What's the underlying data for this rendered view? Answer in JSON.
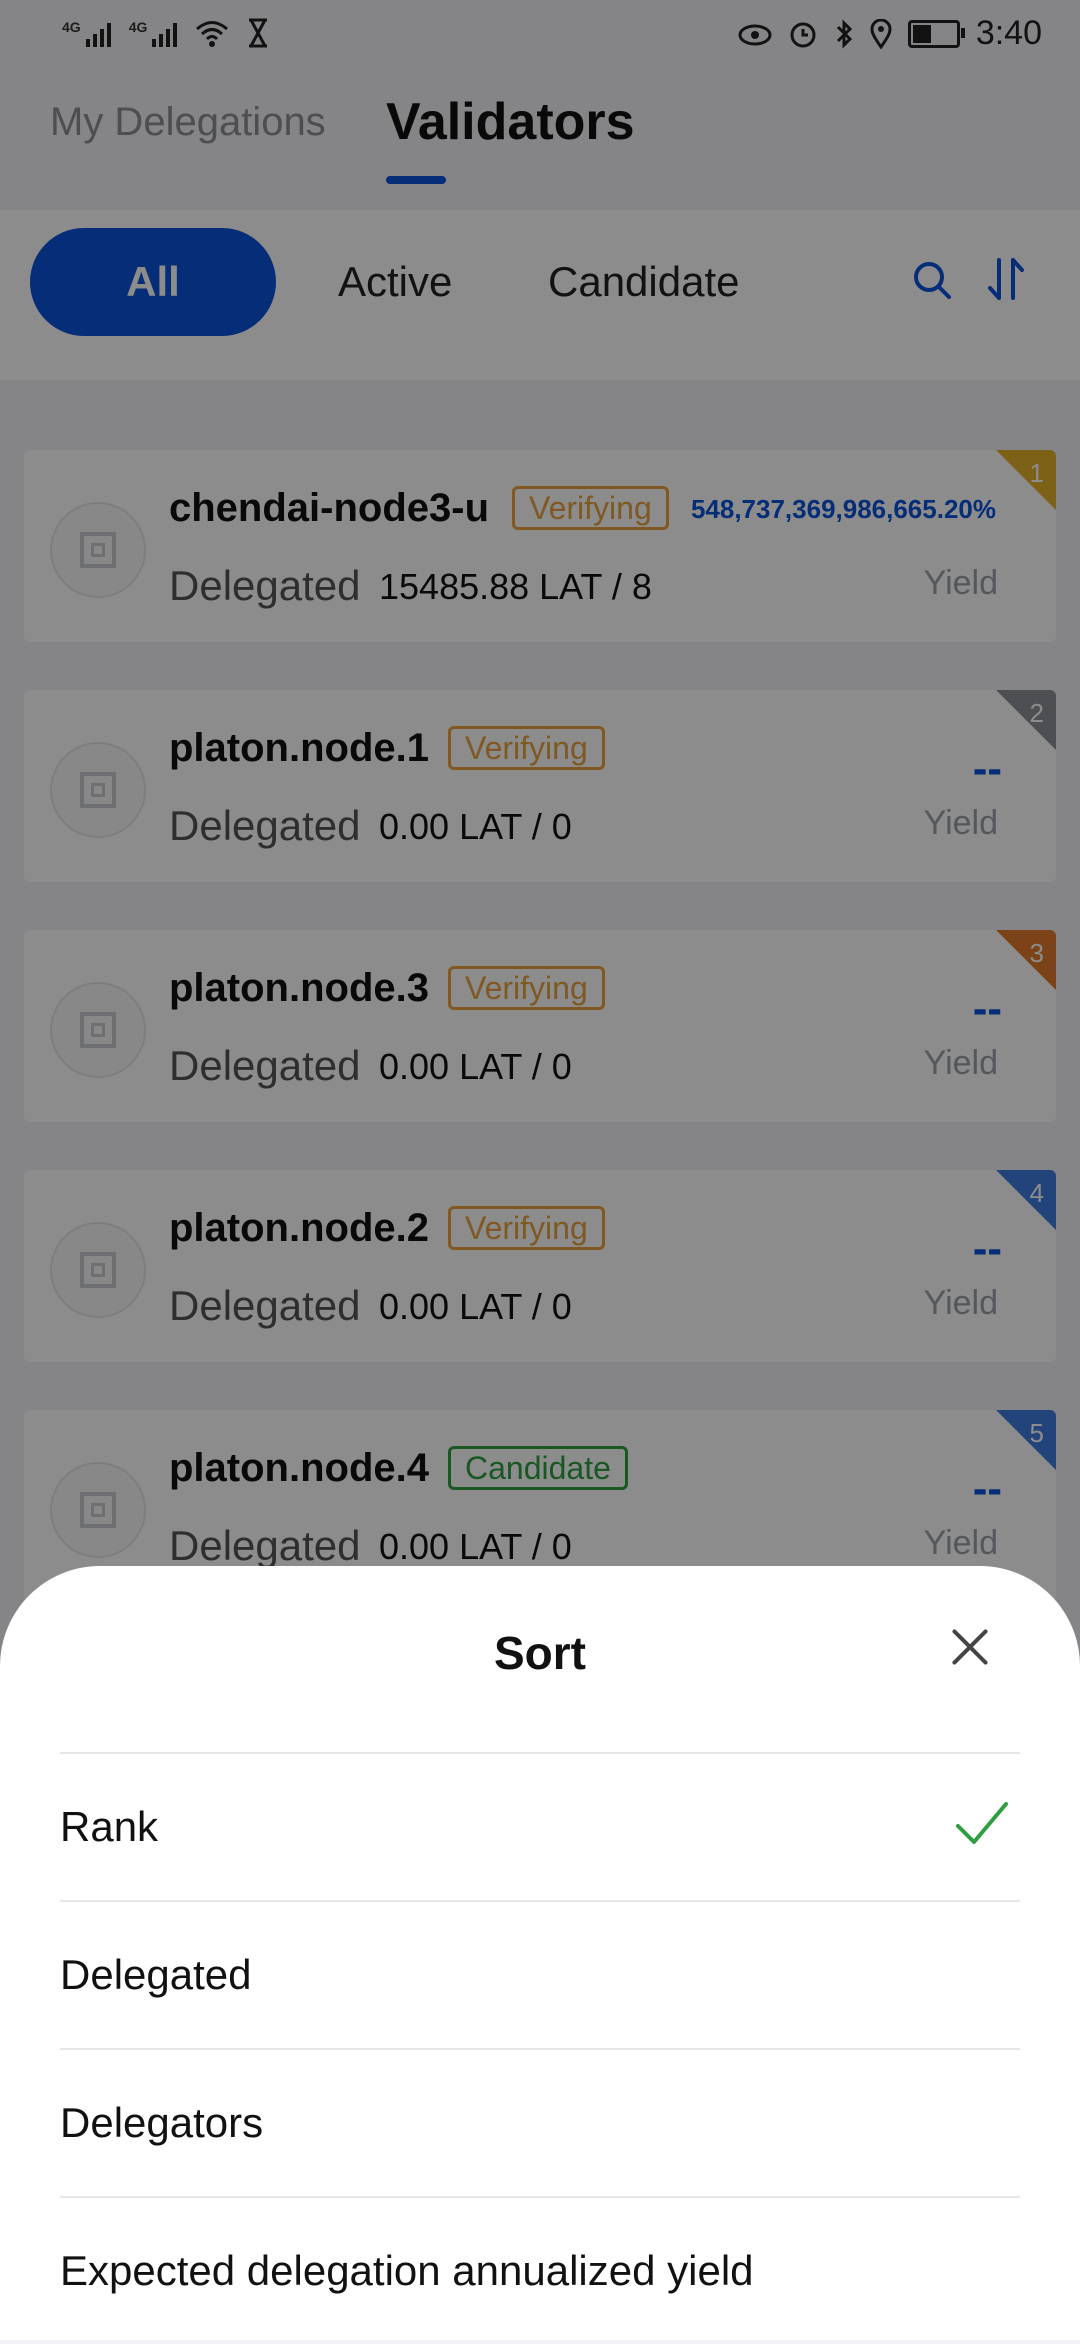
{
  "status_bar": {
    "network_1": "4G",
    "network_2": "4G",
    "time": "3:40"
  },
  "tabs": {
    "my_delegations": "My Delegations",
    "validators": "Validators"
  },
  "filters": {
    "all": "All",
    "active": "Active",
    "candidate": "Candidate"
  },
  "validators": [
    {
      "name": "chendai-node3-u",
      "status": "Verifying",
      "delegated_label": "Delegated",
      "delegated": "15485.88 LAT / 8",
      "yield": "548,737,369,986,665.20%",
      "yield_label": "Yield",
      "rank": "1"
    },
    {
      "name": "platon.node.1",
      "status": "Verifying",
      "delegated_label": "Delegated",
      "delegated": "0.00 LAT / 0",
      "yield": "--",
      "yield_label": "Yield",
      "rank": "2"
    },
    {
      "name": "platon.node.3",
      "status": "Verifying",
      "delegated_label": "Delegated",
      "delegated": "0.00 LAT / 0",
      "yield": "--",
      "yield_label": "Yield",
      "rank": "3"
    },
    {
      "name": "platon.node.2",
      "status": "Verifying",
      "delegated_label": "Delegated",
      "delegated": "0.00 LAT / 0",
      "yield": "--",
      "yield_label": "Yield",
      "rank": "4"
    },
    {
      "name": "platon.node.4",
      "status": "Candidate",
      "delegated_label": "Delegated",
      "delegated": "0.00 LAT / 0",
      "yield": "--",
      "yield_label": "Yield",
      "rank": "5"
    }
  ],
  "sort_sheet": {
    "title": "Sort",
    "options": [
      "Rank",
      "Delegated",
      "Delegators",
      "Expected delegation annualized yield"
    ],
    "selected": "Rank"
  },
  "colors": {
    "accent": "#0b52d9",
    "verifying": "#e8a33d",
    "candidate": "#2e9e41",
    "check": "#2e9e41",
    "rank_1": "#e3b12a",
    "rank_2": "#8e9196",
    "rank_3": "#e07b2a",
    "rank_4": "#3f7de0",
    "rank_5": "#3f7de0"
  }
}
